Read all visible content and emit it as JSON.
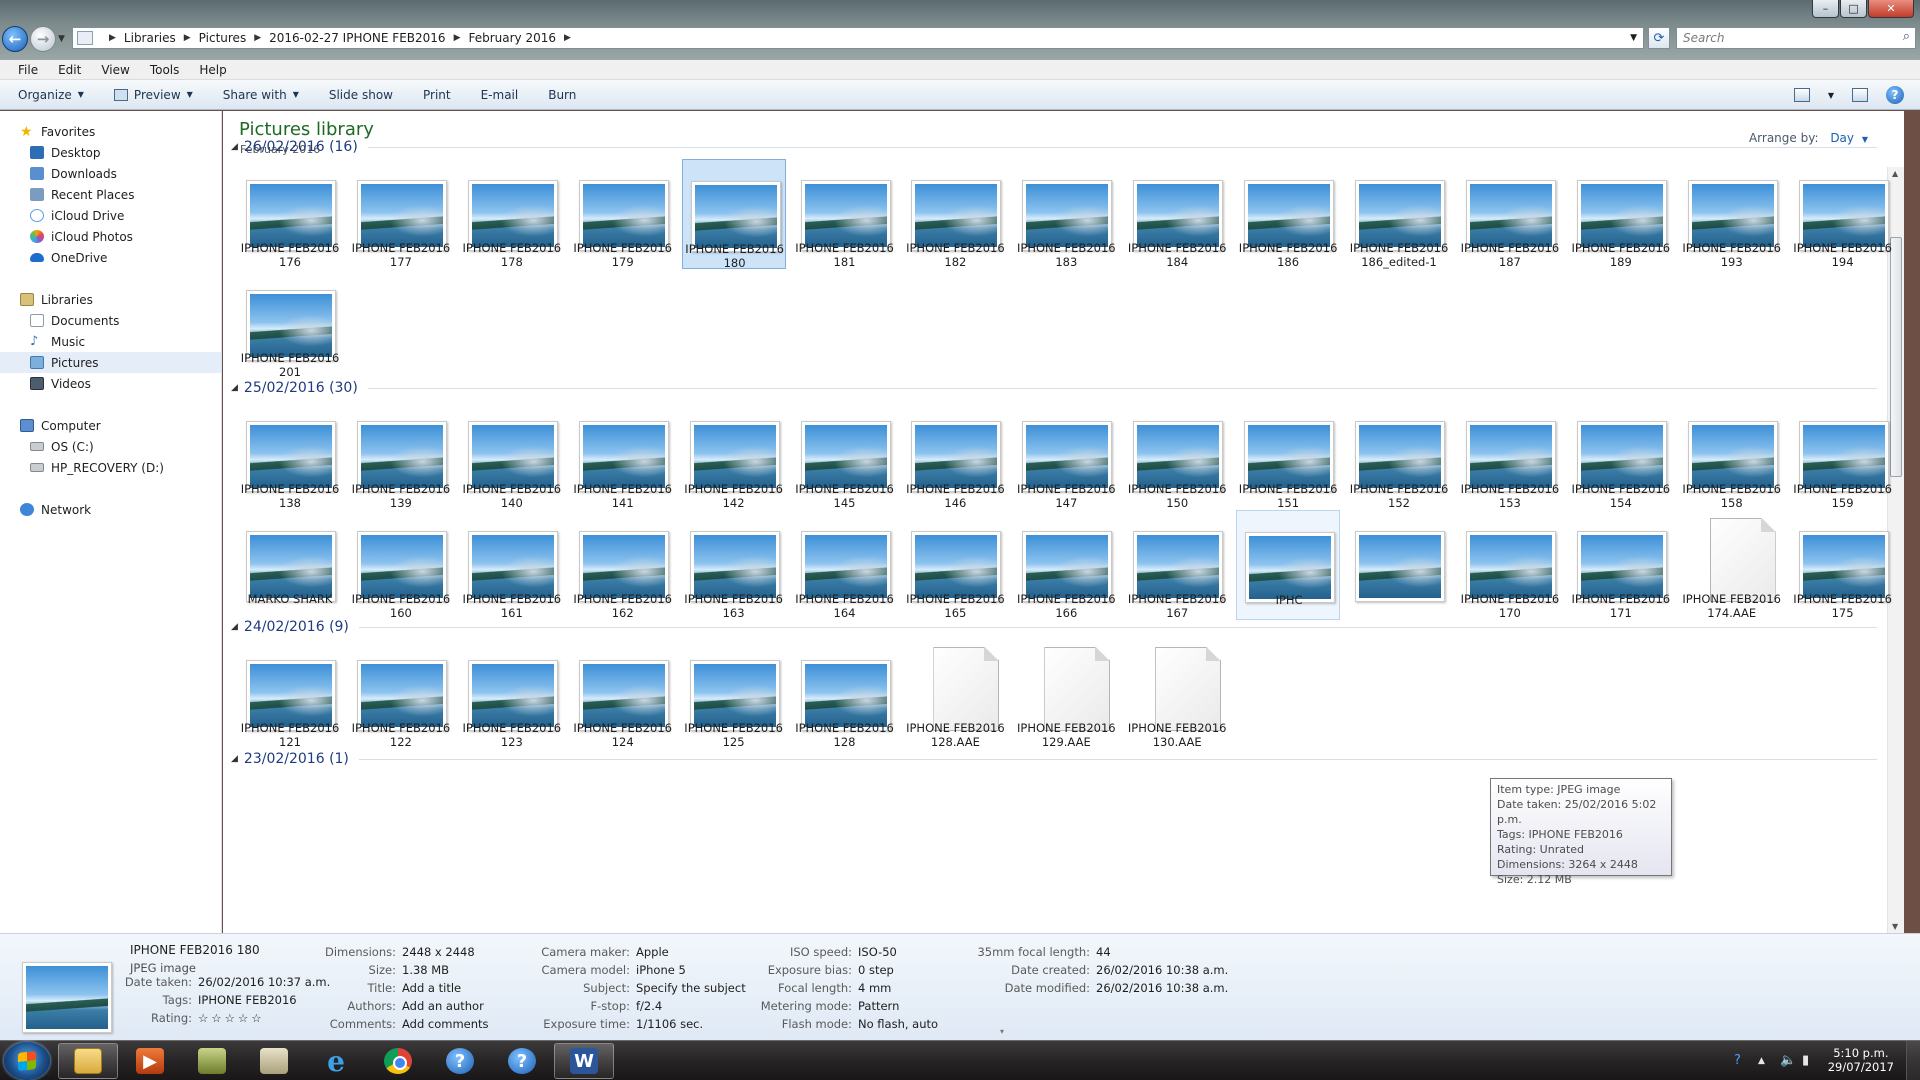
{
  "window": {
    "controls": [
      "–",
      "□",
      "✕"
    ]
  },
  "address": {
    "crumbs": [
      "Libraries",
      "Pictures",
      "2016-02-27 IPHONE FEB2016",
      "February 2016"
    ],
    "search_placeholder": "Search"
  },
  "menu": [
    "File",
    "Edit",
    "View",
    "Tools",
    "Help"
  ],
  "toolbar": {
    "organize": "Organize",
    "preview": "Preview",
    "share": "Share with",
    "slideshow": "Slide show",
    "print": "Print",
    "email": "E-mail",
    "burn": "Burn"
  },
  "nav": {
    "favorites": "Favorites",
    "fav_items": [
      "Desktop",
      "Downloads",
      "Recent Places",
      "iCloud Drive",
      "iCloud Photos",
      "OneDrive"
    ],
    "libraries": "Libraries",
    "lib_items": [
      "Documents",
      "Music",
      "Pictures",
      "Videos"
    ],
    "computer": "Computer",
    "comp_items": [
      "OS (C:)",
      "HP_RECOVERY (D:)"
    ],
    "network": "Network"
  },
  "library": {
    "title": "Pictures library",
    "subtitle": "February 2016",
    "arrange_label": "Arrange by:",
    "arrange_value": "Day"
  },
  "groups": [
    {
      "header": "26/02/2016 (16)",
      "items": [
        {
          "l1": "IPHONE FEB2016",
          "l2": "176",
          "kind": "image"
        },
        {
          "l1": "IPHONE FEB2016",
          "l2": "177",
          "kind": "image"
        },
        {
          "l1": "IPHONE FEB2016",
          "l2": "178",
          "kind": "image"
        },
        {
          "l1": "IPHONE FEB2016",
          "l2": "179",
          "kind": "image"
        },
        {
          "l1": "IPHONE FEB2016",
          "l2": "180",
          "kind": "image",
          "selected": true
        },
        {
          "l1": "IPHONE FEB2016",
          "l2": "181",
          "kind": "image"
        },
        {
          "l1": "IPHONE FEB2016",
          "l2": "182",
          "kind": "image"
        },
        {
          "l1": "IPHONE FEB2016",
          "l2": "183",
          "kind": "image"
        },
        {
          "l1": "IPHONE FEB2016",
          "l2": "184",
          "kind": "image"
        },
        {
          "l1": "IPHONE FEB2016",
          "l2": "186",
          "kind": "image"
        },
        {
          "l1": "IPHONE FEB2016",
          "l2": "186_edited-1",
          "kind": "image"
        },
        {
          "l1": "IPHONE FEB2016",
          "l2": "187",
          "kind": "image"
        },
        {
          "l1": "IPHONE FEB2016",
          "l2": "189",
          "kind": "image"
        },
        {
          "l1": "IPHONE FEB2016",
          "l2": "193",
          "kind": "image"
        },
        {
          "l1": "IPHONE FEB2016",
          "l2": "194",
          "kind": "image"
        },
        {
          "l1": "IPHONE FEB2016",
          "l2": "201",
          "kind": "image"
        }
      ]
    },
    {
      "header": "25/02/2016 (30)",
      "items": [
        {
          "l1": "IPHONE FEB2016",
          "l2": "138",
          "kind": "image"
        },
        {
          "l1": "IPHONE FEB2016",
          "l2": "139",
          "kind": "image"
        },
        {
          "l1": "IPHONE FEB2016",
          "l2": "140",
          "kind": "image"
        },
        {
          "l1": "IPHONE FEB2016",
          "l2": "141",
          "kind": "image"
        },
        {
          "l1": "IPHONE FEB2016",
          "l2": "142",
          "kind": "image"
        },
        {
          "l1": "IPHONE FEB2016",
          "l2": "145",
          "kind": "image"
        },
        {
          "l1": "IPHONE FEB2016",
          "l2": "146",
          "kind": "image"
        },
        {
          "l1": "IPHONE FEB2016",
          "l2": "147",
          "kind": "image"
        },
        {
          "l1": "IPHONE FEB2016",
          "l2": "150",
          "kind": "image"
        },
        {
          "l1": "IPHONE FEB2016",
          "l2": "151",
          "kind": "image"
        },
        {
          "l1": "IPHONE FEB2016",
          "l2": "152",
          "kind": "image"
        },
        {
          "l1": "IPHONE FEB2016",
          "l2": "153",
          "kind": "image"
        },
        {
          "l1": "IPHONE FEB2016",
          "l2": "154",
          "kind": "image"
        },
        {
          "l1": "IPHONE FEB2016",
          "l2": "158",
          "kind": "image"
        },
        {
          "l1": "IPHONE FEB2016",
          "l2": "159",
          "kind": "image"
        },
        {
          "l1": "MARKO SHARK",
          "l2": "",
          "kind": "image"
        },
        {
          "l1": "IPHONE FEB2016",
          "l2": "160",
          "kind": "image"
        },
        {
          "l1": "IPHONE FEB2016",
          "l2": "161",
          "kind": "image"
        },
        {
          "l1": "IPHONE FEB2016",
          "l2": "162",
          "kind": "image"
        },
        {
          "l1": "IPHONE FEB2016",
          "l2": "163",
          "kind": "image"
        },
        {
          "l1": "IPHONE FEB2016",
          "l2": "164",
          "kind": "image"
        },
        {
          "l1": "IPHONE FEB2016",
          "l2": "165",
          "kind": "image"
        },
        {
          "l1": "IPHONE FEB2016",
          "l2": "166",
          "kind": "image"
        },
        {
          "l1": "IPHONE FEB2016",
          "l2": "167",
          "kind": "image"
        },
        {
          "l1": "IPHC",
          "l2": "",
          "kind": "image",
          "hover": true
        },
        {
          "l1": "",
          "l2": "",
          "kind": "image"
        },
        {
          "l1": "IPHONE FEB2016",
          "l2": "170",
          "kind": "image"
        },
        {
          "l1": "IPHONE FEB2016",
          "l2": "171",
          "kind": "image"
        },
        {
          "l1": "IPHONE FEB2016",
          "l2": "174.AAE",
          "kind": "file"
        },
        {
          "l1": "IPHONE FEB2016",
          "l2": "175",
          "kind": "image"
        }
      ]
    },
    {
      "header": "24/02/2016 (9)",
      "items": [
        {
          "l1": "IPHONE FEB2016",
          "l2": "121",
          "kind": "image"
        },
        {
          "l1": "IPHONE FEB2016",
          "l2": "122",
          "kind": "image"
        },
        {
          "l1": "IPHONE FEB2016",
          "l2": "123",
          "kind": "image"
        },
        {
          "l1": "IPHONE FEB2016",
          "l2": "124",
          "kind": "image"
        },
        {
          "l1": "IPHONE FEB2016",
          "l2": "125",
          "kind": "image"
        },
        {
          "l1": "IPHONE FEB2016",
          "l2": "128",
          "kind": "image"
        },
        {
          "l1": "IPHONE FEB2016",
          "l2": "128.AAE",
          "kind": "file"
        },
        {
          "l1": "IPHONE FEB2016",
          "l2": "129.AAE",
          "kind": "file"
        },
        {
          "l1": "IPHONE FEB2016",
          "l2": "130.AAE",
          "kind": "file"
        }
      ]
    },
    {
      "header": "23/02/2016 (1)",
      "items": []
    }
  ],
  "tooltip": [
    "Item type: JPEG image",
    "Date taken: 25/02/2016 5:02 p.m.",
    "Tags: IPHONE FEB2016",
    "Rating: Unrated",
    "Dimensions: 3264 x 2448",
    "Size: 2.12 MB"
  ],
  "details": {
    "name": "IPHONE FEB2016 180",
    "type": "JPEG image",
    "col0": [
      [
        "Date taken:",
        "26/02/2016 10:37 a.m."
      ],
      [
        "Tags:",
        "IPHONE FEB2016"
      ],
      [
        "Rating:",
        "☆☆☆☆☆"
      ]
    ],
    "col1": [
      [
        "Dimensions:",
        "2448 x 2448"
      ],
      [
        "Size:",
        "1.38 MB"
      ],
      [
        "Title:",
        "Add a title"
      ],
      [
        "Authors:",
        "Add an author"
      ],
      [
        "Comments:",
        "Add comments"
      ]
    ],
    "col2": [
      [
        "Camera maker:",
        "Apple"
      ],
      [
        "Camera model:",
        "iPhone 5"
      ],
      [
        "Subject:",
        "Specify the subject"
      ],
      [
        "F-stop:",
        "f/2.4"
      ],
      [
        "Exposure time:",
        "1/1106 sec."
      ]
    ],
    "col3": [
      [
        "ISO speed:",
        "ISO-50"
      ],
      [
        "Exposure bias:",
        "0 step"
      ],
      [
        "Focal length:",
        "4 mm"
      ],
      [
        "Metering mode:",
        "Pattern"
      ],
      [
        "Flash mode:",
        "No flash, auto"
      ]
    ],
    "col4": [
      [
        "35mm focal length:",
        "44"
      ],
      [
        "Date created:",
        "26/02/2016 10:38 a.m."
      ],
      [
        "Date modified:",
        "26/02/2016 10:38 a.m."
      ]
    ]
  },
  "taskbar": {
    "time": "5:10 p.m.",
    "date": "29/07/2017",
    "apps": [
      "windows-explorer",
      "media-player",
      "app",
      "pictures",
      "internet-explorer",
      "chrome",
      "help",
      "help",
      "word"
    ],
    "ie_glyph": "e",
    "help_glyph": "?",
    "word_glyph": "W"
  }
}
